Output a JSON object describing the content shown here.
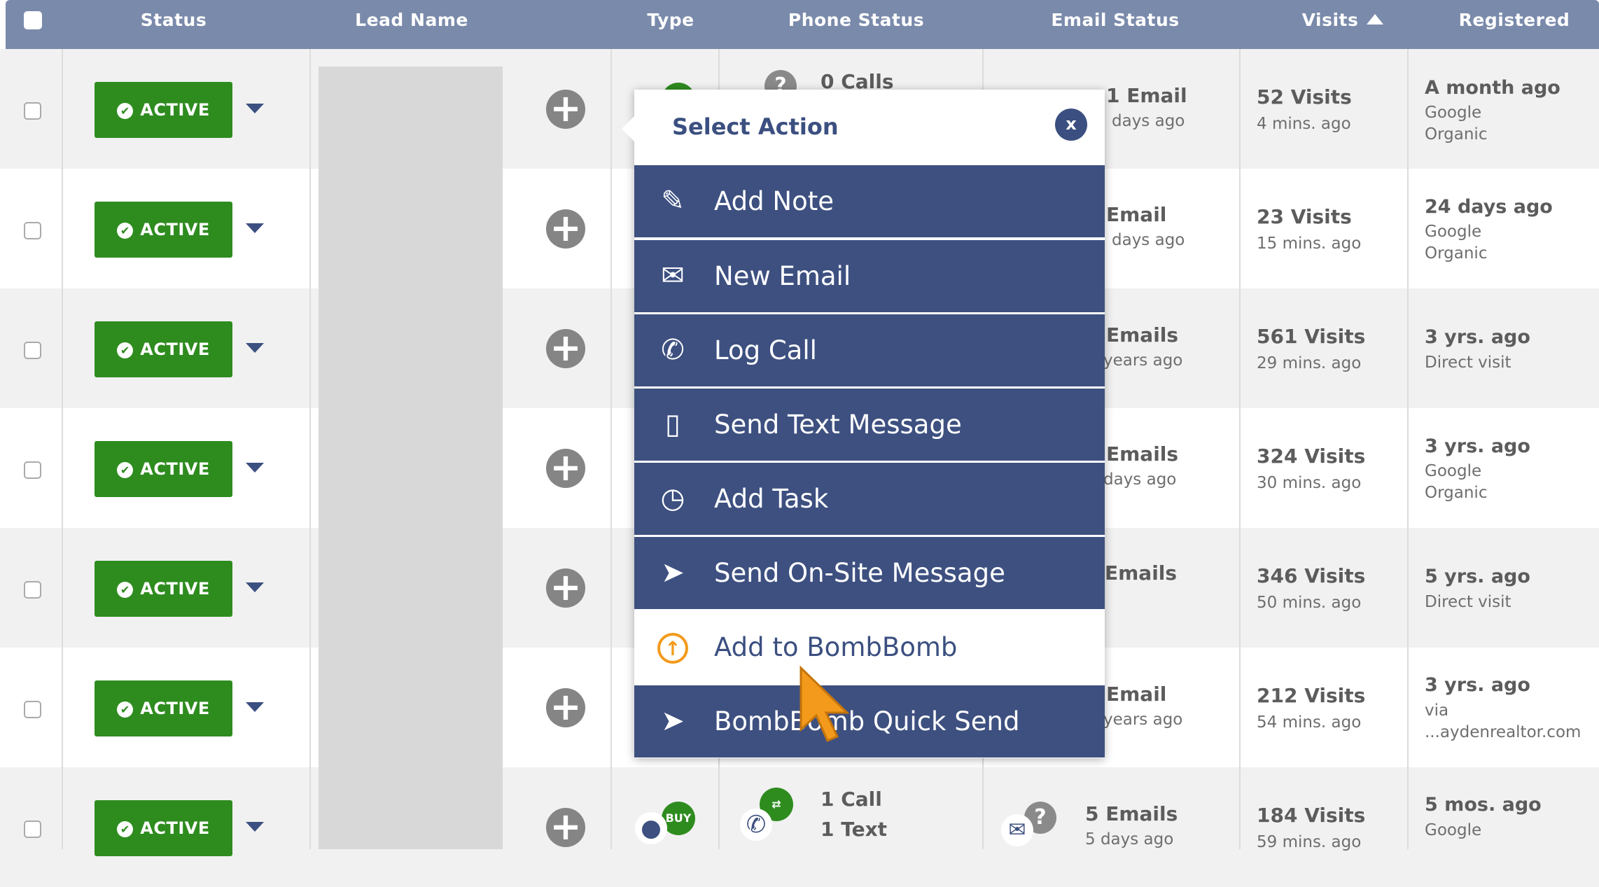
{
  "header": {
    "status": "Status",
    "lead_name": "Lead Name",
    "type": "Type",
    "phone_status": "Phone Status",
    "email_status": "Email Status",
    "visits": "Visits",
    "registered": "Registered"
  },
  "rows": [
    {
      "status": "ACTIVE",
      "phone_main": "0 Calls",
      "email_main": "1 Email",
      "email_sub": "days ago",
      "visits": "52 Visits",
      "visits_sub": "4 mins. ago",
      "reg_main": "A month ago",
      "reg_line1": "Google",
      "reg_line2": "Organic"
    },
    {
      "status": "ACTIVE",
      "email_main": "Email",
      "email_sub": "days ago",
      "visits": "23 Visits",
      "visits_sub": "15 mins. ago",
      "reg_main": "24 days ago",
      "reg_line1": "Google",
      "reg_line2": "Organic"
    },
    {
      "status": "ACTIVE",
      "email_main": "Emails",
      "email_sub": "years ago",
      "visits": "561 Visits",
      "visits_sub": "29 mins. ago",
      "reg_main": "3 yrs. ago",
      "reg_line1": "Direct visit"
    },
    {
      "status": "ACTIVE",
      "email_main": "Emails",
      "email_sub": "days ago",
      "visits": "324 Visits",
      "visits_sub": "30 mins. ago",
      "reg_main": "3 yrs. ago",
      "reg_line1": "Google",
      "reg_line2": "Organic"
    },
    {
      "status": "ACTIVE",
      "email_main": "Emails",
      "visits": "346 Visits",
      "visits_sub": "50 mins. ago",
      "reg_main": "5 yrs. ago",
      "reg_line1": "Direct visit"
    },
    {
      "status": "ACTIVE",
      "email_main": "Email",
      "email_sub": "years ago",
      "visits": "212 Visits",
      "visits_sub": "54 mins. ago",
      "reg_main": "3 yrs. ago",
      "reg_line1": "via",
      "reg_line2": "...aydenrealtor.com"
    },
    {
      "status": "ACTIVE",
      "type_badge": "BUY",
      "phone_main": "1 Call",
      "phone_sub": "1 Text",
      "email_main": "5 Emails",
      "email_sub": "5 days ago",
      "visits": "184 Visits",
      "visits_sub": "59 mins. ago",
      "reg_main": "5 mos. ago",
      "reg_line1": "Google"
    }
  ],
  "popup": {
    "title": "Select Action",
    "close": "x",
    "items": [
      {
        "label": "Add Note",
        "icon": "pencil-icon"
      },
      {
        "label": "New Email",
        "icon": "envelope-icon"
      },
      {
        "label": "Log Call",
        "icon": "phone-icon"
      },
      {
        "label": "Send Text Message",
        "icon": "mobile-icon"
      },
      {
        "label": "Add Task",
        "icon": "clock-icon"
      },
      {
        "label": "Send On-Site Message",
        "icon": "paper-plane-icon"
      },
      {
        "label": "Add to BombBomb",
        "icon": "upload-circle-icon"
      },
      {
        "label": "BombBomb Quick Send",
        "icon": "paper-plane-icon"
      }
    ]
  },
  "colors": {
    "header_bg": "#7a8aab",
    "active_green": "#2e8c1f",
    "menu_bg": "#3d5080",
    "accent_orange": "#f39a1c"
  }
}
